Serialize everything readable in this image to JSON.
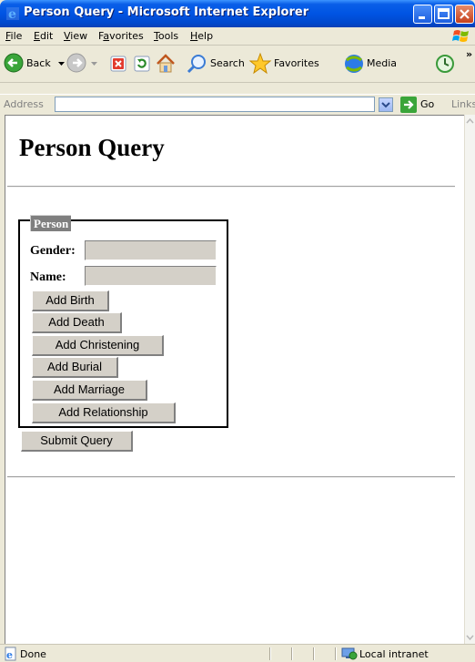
{
  "window": {
    "title": "Person Query - Microsoft Internet Explorer",
    "title_icon": "ie-icon",
    "controls": [
      "minimize-icon",
      "maximize-icon",
      "close-icon"
    ]
  },
  "menu": {
    "items": [
      {
        "label": "File",
        "underline": "F",
        "rest": "ile"
      },
      {
        "label": "Edit",
        "underline": "E",
        "rest": "dit"
      },
      {
        "label": "View",
        "underline": "V",
        "rest": "iew"
      },
      {
        "label": "Favorites",
        "underline": "a",
        "pre": "F",
        "rest": "vorites"
      },
      {
        "label": "Tools",
        "underline": "T",
        "rest": "ools"
      },
      {
        "label": "Help",
        "underline": "H",
        "rest": "elp"
      }
    ]
  },
  "toolbar": {
    "back_label": "Back",
    "search_label": "Search",
    "favorites_label": "Favorites",
    "media_label": "Media",
    "overflow_label": "»"
  },
  "address": {
    "label": "Address",
    "value": "",
    "go_label": "Go",
    "links_label": "Links"
  },
  "page": {
    "title": "Person Query",
    "fieldset_legend": "Person",
    "gender_label": "Gender:",
    "gender_value": "",
    "name_label": "Name:",
    "name_value": "",
    "buttons": {
      "add_birth": "Add Birth",
      "add_death": "Add Death",
      "add_christening": "Add Christening",
      "add_burial": "Add Burial",
      "add_marriage": "Add Marriage",
      "add_relationship": "Add Relationship"
    },
    "submit_label": "Submit Query"
  },
  "status": {
    "text": "Done",
    "zone": "Local intranet"
  },
  "colors": {
    "titlebar": "#0054e3",
    "chrome": "#ece9d8",
    "button_face": "#d4d0c8",
    "legend_bg": "#7f7f7f"
  }
}
